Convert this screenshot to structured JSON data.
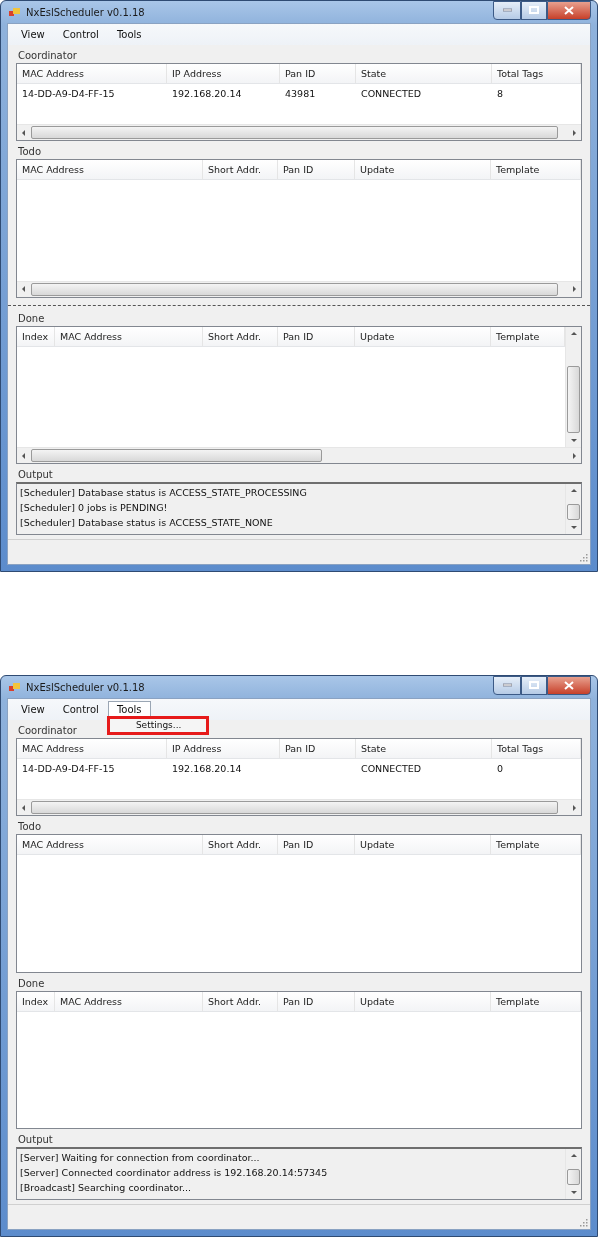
{
  "windows": [
    {
      "title": "NxEslScheduler v0.1.18",
      "menu": [
        {
          "label": "View",
          "open": false
        },
        {
          "label": "Control",
          "open": false
        },
        {
          "label": "Tools",
          "open": false
        }
      ],
      "splitter": true,
      "sections": [
        {
          "kind": "coordinator",
          "label": "Coordinator",
          "horizontal_scroll": true,
          "columns": [
            "MAC Address",
            "IP Address",
            "Pan ID",
            "State",
            "Total Tags"
          ],
          "rows": [
            [
              "14-DD-A9-D4-FF-15",
              "192.168.20.14",
              "43981",
              "CONNECTED",
              "8"
            ]
          ]
        },
        {
          "kind": "todo",
          "label": "Todo",
          "horizontal_scroll": true,
          "columns": [
            "MAC Address",
            "Short Addr.",
            "Pan ID",
            "Update",
            "Template"
          ]
        },
        {
          "kind": "done",
          "label": "Done",
          "horizontal_scroll": true,
          "vertical_scroll": true,
          "columns": [
            "Index",
            "MAC Address",
            "Short Addr.",
            "Pan ID",
            "Update",
            "Template"
          ]
        }
      ],
      "output": {
        "label": "Output",
        "lines": [
          "[Scheduler] Database status is ACCESS_STATE_PROCESSING",
          "[Scheduler] 0 jobs is PENDING!",
          "[Scheduler] Database status is ACCESS_STATE_NONE"
        ]
      }
    },
    {
      "title": "NxEslScheduler v0.1.18",
      "menu": [
        {
          "label": "View",
          "open": false
        },
        {
          "label": "Control",
          "open": false
        },
        {
          "label": "Tools",
          "open": true,
          "items": [
            {
              "label": "Settings...",
              "annotated": true
            }
          ]
        }
      ],
      "sections": [
        {
          "kind": "coordinator",
          "label": "Coordinator",
          "horizontal_scroll": true,
          "columns": [
            "MAC Address",
            "IP Address",
            "Pan ID",
            "State",
            "Total Tags"
          ],
          "rows": [
            [
              "14-DD-A9-D4-FF-15",
              "192.168.20.14",
              "",
              "CONNECTED",
              "0"
            ]
          ]
        },
        {
          "kind": "todo",
          "label": "Todo",
          "columns": [
            "MAC Address",
            "Short Addr.",
            "Pan ID",
            "Update",
            "Template"
          ]
        },
        {
          "kind": "done",
          "label": "Done",
          "columns": [
            "Index",
            "MAC Address",
            "Short Addr.",
            "Pan ID",
            "Update",
            "Template"
          ]
        }
      ],
      "output": {
        "label": "Output",
        "lines": [
          "[Server] Waiting for connection from coordinator...",
          "[Server] Connected coordinator address is 192.168.20.14:57345",
          "[Broadcast] Searching coordinator..."
        ]
      }
    }
  ]
}
